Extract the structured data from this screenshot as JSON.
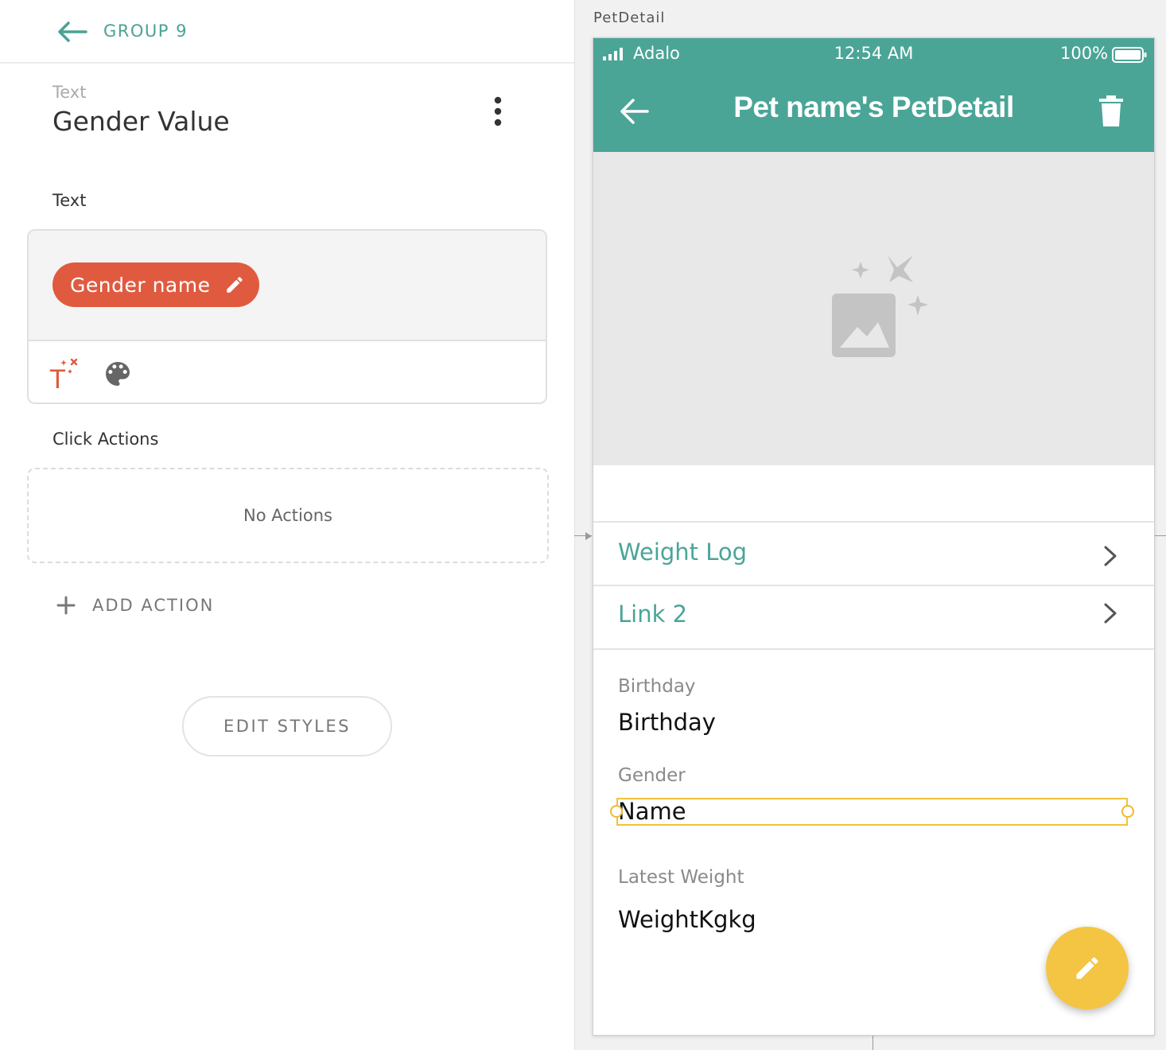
{
  "panel": {
    "group_title": "GROUP 9",
    "component_type": "Text",
    "component_name": "Gender Value",
    "text_section_label": "Text",
    "magic_text_chip": "Gender name",
    "click_actions_label": "Click Actions",
    "no_actions": "No Actions",
    "add_action": "ADD ACTION",
    "edit_styles": "EDIT STYLES"
  },
  "canvas": {
    "screen_label": "PetDetail"
  },
  "phone": {
    "status": {
      "carrier": "Adalo",
      "time": "12:54 AM",
      "battery": "100%"
    },
    "title": "Pet name's PetDetail",
    "links": [
      {
        "label": "Weight Log"
      },
      {
        "label": "Link 2"
      }
    ],
    "fields": [
      {
        "label": "Birthday",
        "value": "Birthday"
      },
      {
        "label": "Gender",
        "value": "Name"
      },
      {
        "label": "Latest Weight",
        "value": "WeightKgkg"
      }
    ]
  },
  "colors": {
    "accent": "#4aa597",
    "magic_chip": "#e05a3f",
    "fab": "#f4c542",
    "selection": "#f2c23a"
  },
  "icons": [
    "back-arrow-icon",
    "more-vertical-icon",
    "pencil-icon",
    "magic-text-icon",
    "palette-icon",
    "plus-icon",
    "signal-icon",
    "battery-icon",
    "delete-icon",
    "image-placeholder-icon",
    "chevron-right-icon"
  ]
}
